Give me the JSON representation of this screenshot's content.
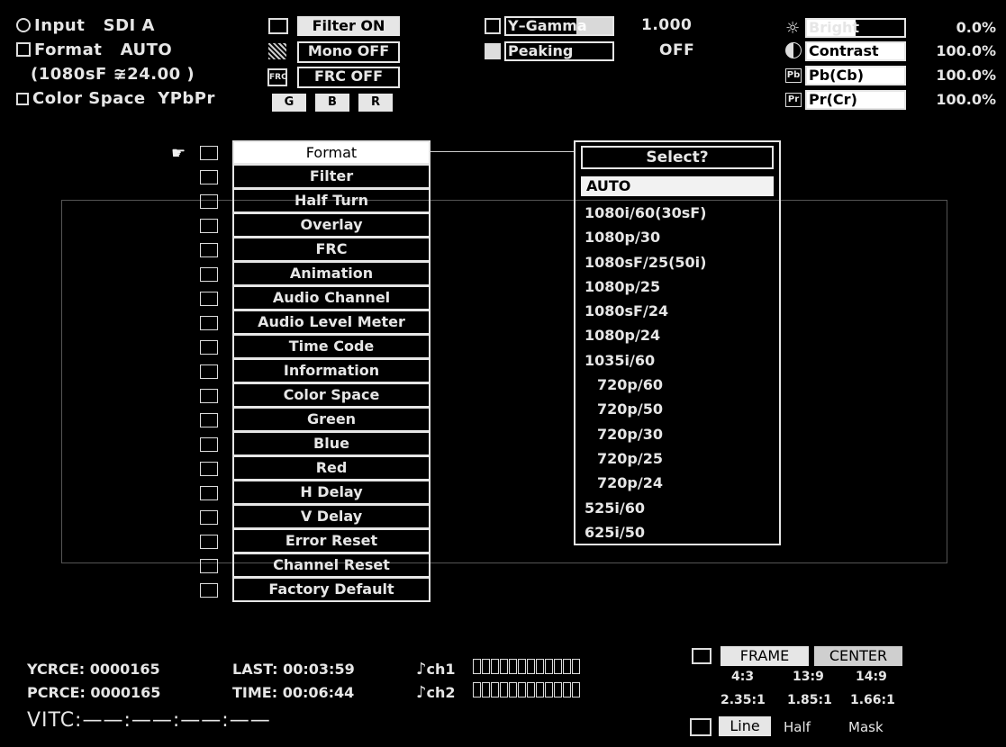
{
  "status": {
    "input_label": "Input",
    "input_value": "SDI A",
    "format_label": "Format",
    "format_value": "AUTO",
    "format_detail": "(1080sF ≆24.00 )",
    "colorspace_label": "Color Space",
    "colorspace_value": "YPbPr"
  },
  "toggles": {
    "filter": "Filter  ON",
    "mono": "Mono  OFF",
    "frc": "FRC  OFF",
    "g": "G",
    "b": "B",
    "r": "R"
  },
  "gamma": {
    "ygamma_label": "Y–Gamma",
    "ygamma_value": "1.000",
    "peaking_label": "Peaking",
    "peaking_value": "OFF"
  },
  "levels": {
    "bright_label": "Bright",
    "bright_value": "0.0%",
    "contrast_label": "Contrast",
    "contrast_value": "100.0%",
    "pb_label": "Pb(Cb)",
    "pb_value": "100.0%",
    "pr_label": "Pr(Cr)",
    "pr_value": "100.0%"
  },
  "menu": {
    "items": [
      "Format",
      "Filter",
      "Half  Turn",
      "Overlay",
      "FRC",
      "Animation",
      "Audio  Channel",
      "Audio  Level  Meter",
      "Time  Code",
      "Information",
      "Color  Space",
      "Green",
      "Blue",
      "Red",
      "H  Delay",
      "V  Delay",
      "Error  Reset",
      "Channel  Reset",
      "Factory  Default"
    ],
    "icons": [
      "tv",
      "filter",
      "half-turn",
      "overlay",
      "FRC",
      "animation",
      "note",
      "notes",
      "clock",
      "123",
      "ycc",
      "G",
      "B",
      "R",
      "h-delay",
      "v-delay",
      "error",
      "channel",
      "factory"
    ]
  },
  "select": {
    "title": "Select?",
    "options": [
      "AUTO",
      "1080i/60(30sF)",
      "1080p/30",
      "1080sF/25(50i)",
      "1080p/25",
      "1080sF/24",
      "1080p/24",
      "1035i/60",
      "720p/60",
      "720p/50",
      "720p/30",
      "720p/25",
      "720p/24",
      "525i/60",
      "625i/50"
    ]
  },
  "counters": {
    "ycrce": "YCRCE: 0000165",
    "pcrce": "PCRCE: 0000165",
    "last": "LAST: 00:03:59",
    "time": "TIME: 00:06:44",
    "vitc": "VITC:——:——:——:——",
    "ch1": "ch1",
    "ch2": "ch2"
  },
  "marker": {
    "frame": "FRAME",
    "center": "CENTER",
    "r1": "4:3",
    "r2": "13:9",
    "r3": "14:9",
    "r4": "2.35:1",
    "r5": "1.85:1",
    "r6": "1.66:1",
    "line": "Line",
    "half": "Half",
    "mask": "Mask"
  }
}
